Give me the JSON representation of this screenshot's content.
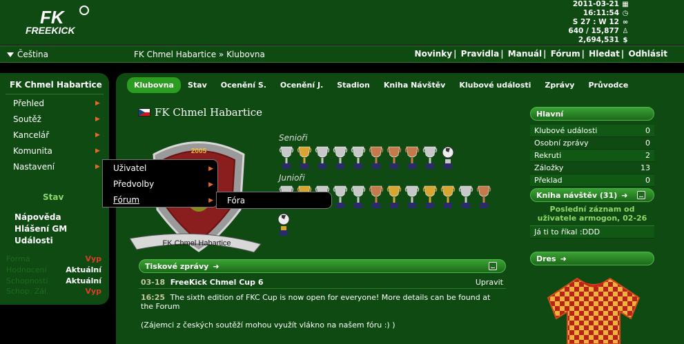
{
  "header": {
    "logo_text": "FREEKICK",
    "logo_mark": "FK",
    "date": "2011-03-21",
    "time": "16:11:54",
    "season": "S 27 : W 12",
    "users": "640 / 15,877",
    "money": "2,694,531"
  },
  "nav": {
    "language": "Čeština",
    "breadcrumb": "FK Chmel Habartice » Klubovna",
    "links": [
      "Novinky",
      "Pravidla",
      "Manuál",
      "Fórum",
      "Hledat",
      "Odhlásit"
    ]
  },
  "sidebar": {
    "club_name": "FK Chmel Habartice",
    "items": [
      {
        "label": "Přehled"
      },
      {
        "label": "Soutěž"
      },
      {
        "label": "Kancelář"
      },
      {
        "label": "Komunita"
      },
      {
        "label": "Nastavení"
      }
    ],
    "stav_title": "Stav",
    "help_links": [
      "Nápověda",
      "Hlášení GM",
      "Události"
    ],
    "attributes": [
      {
        "label": "Forma",
        "value": "Vyp",
        "status": "off"
      },
      {
        "label": "Hodnocení",
        "value": "Aktuální",
        "status": "on"
      },
      {
        "label": "Schopnosti",
        "value": "Aktuální",
        "status": "on"
      },
      {
        "label": "Schop. Zál.",
        "value": "Vyp",
        "status": "off"
      }
    ]
  },
  "menu": {
    "submenu": [
      "Uživatel",
      "Předvolby",
      "Fórum"
    ],
    "subsubmenu": [
      "Fóra"
    ]
  },
  "tabs": [
    "Klubovna",
    "Stav",
    "Ocenění S.",
    "Ocenění J.",
    "Stadion",
    "Kniha Návštěv",
    "Klubové události",
    "Zprávy",
    "Průvodce"
  ],
  "club": {
    "title": "FK Chmel Habartice",
    "crest_year": "2005",
    "crest_banner": "FK Chmel Habartice",
    "seniors_label": "Senioři",
    "juniors_label": "Junioři"
  },
  "press": {
    "title": "Tiskové zprávy",
    "date": "03-18",
    "headline": "FreeKick Chmel Cup 6",
    "edit_label": "Upravit",
    "time": "16:25",
    "body": "The sixth edition of FKC Cup is now open for everyone! More details can be found at the Forum",
    "body2": "(Zájemci z českých soutěží mohou využít vlákno na našem fóru :) )"
  },
  "panel_main": {
    "title": "Hlavní",
    "rows": [
      {
        "label": "Klubové události",
        "value": "0"
      },
      {
        "label": "Osobní zprávy",
        "value": "0"
      },
      {
        "label": "Rekruti",
        "value": "2"
      },
      {
        "label": "Záložky",
        "value": "13"
      },
      {
        "label": "Překlad",
        "value": "0"
      }
    ]
  },
  "guestbook": {
    "title": "Kniha návštěv (31)",
    "last_post": "Poslední záznam od uživatele armogon, 02-26",
    "message": "Já ti to říkal :DDD"
  },
  "dres": {
    "title": "Dres"
  },
  "colors": {
    "bg_dark": "#0e4a12",
    "accent_green": "#2b9d21",
    "status_red": "#e03c2a",
    "arrow_orange": "#e56a2a"
  }
}
